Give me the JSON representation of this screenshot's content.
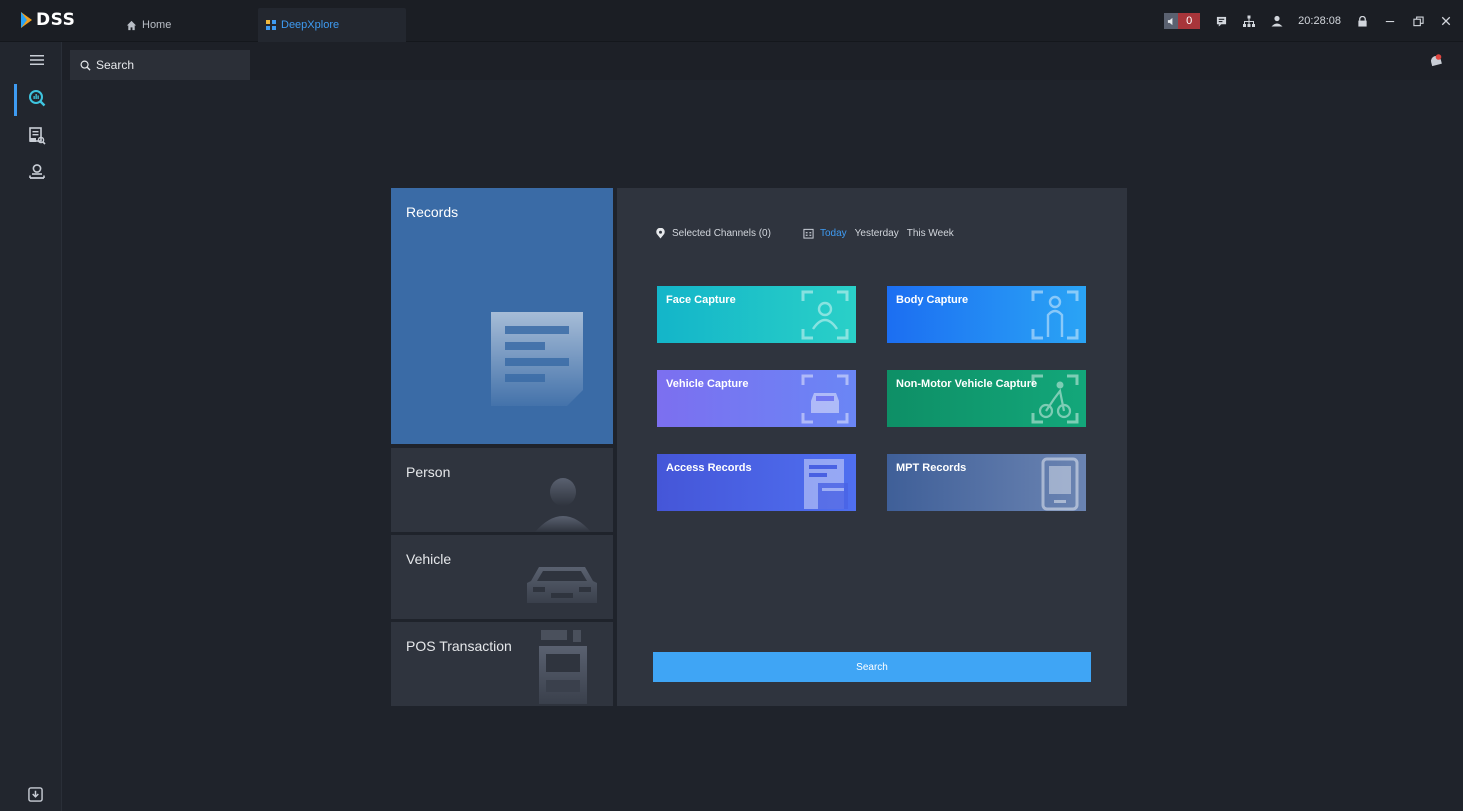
{
  "app": {
    "name": "DSS"
  },
  "tabs": [
    {
      "label": "Home",
      "icon": "home-icon"
    },
    {
      "label": "DeepXplore",
      "icon": "grid-icon",
      "active": true
    }
  ],
  "status_bar": {
    "alarm_count": "0",
    "time": "20:28:08"
  },
  "search": {
    "placeholder": "Search"
  },
  "sidebar": {
    "items": [
      {
        "name": "deepxplore-search-icon",
        "active": true
      },
      {
        "name": "record-search-icon"
      },
      {
        "name": "location-person-icon"
      }
    ]
  },
  "categories": [
    {
      "label": "Records",
      "active": true
    },
    {
      "label": "Person"
    },
    {
      "label": "Vehicle"
    },
    {
      "label": "POS Transaction"
    }
  ],
  "filters": {
    "channels": "Selected Channels (0)",
    "dates": [
      "Today",
      "Yesterday",
      "This Week"
    ],
    "active_date": "Today"
  },
  "capture_types": [
    {
      "label": "Face Capture",
      "color_from": "#13b5c9",
      "color_to": "#2ad0c8",
      "icon": "face-frame-icon"
    },
    {
      "label": "Body Capture",
      "color_from": "#1c6ef2",
      "color_to": "#2aa4f5",
      "icon": "body-frame-icon"
    },
    {
      "label": "Vehicle Capture",
      "color_from": "#7c6ff0",
      "color_to": "#6a86f5",
      "icon": "vehicle-frame-icon"
    },
    {
      "label": "Non-Motor Vehicle Capture",
      "color_from": "#0e8f66",
      "color_to": "#13a77a",
      "icon": "cyclist-frame-icon"
    },
    {
      "label": "Access Records",
      "color_from": "#4556d8",
      "color_to": "#4f6ff0",
      "icon": "access-record-icon"
    },
    {
      "label": "MPT Records",
      "color_from": "#3f5f98",
      "color_to": "#6b84b2",
      "icon": "mpt-device-icon"
    }
  ],
  "actions": {
    "search_label": "Search"
  },
  "colors": {
    "accent": "#3e9bf2",
    "panel": "#2f343e",
    "records_active": "#3a6ba6",
    "search_button": "#3fa5f5"
  }
}
